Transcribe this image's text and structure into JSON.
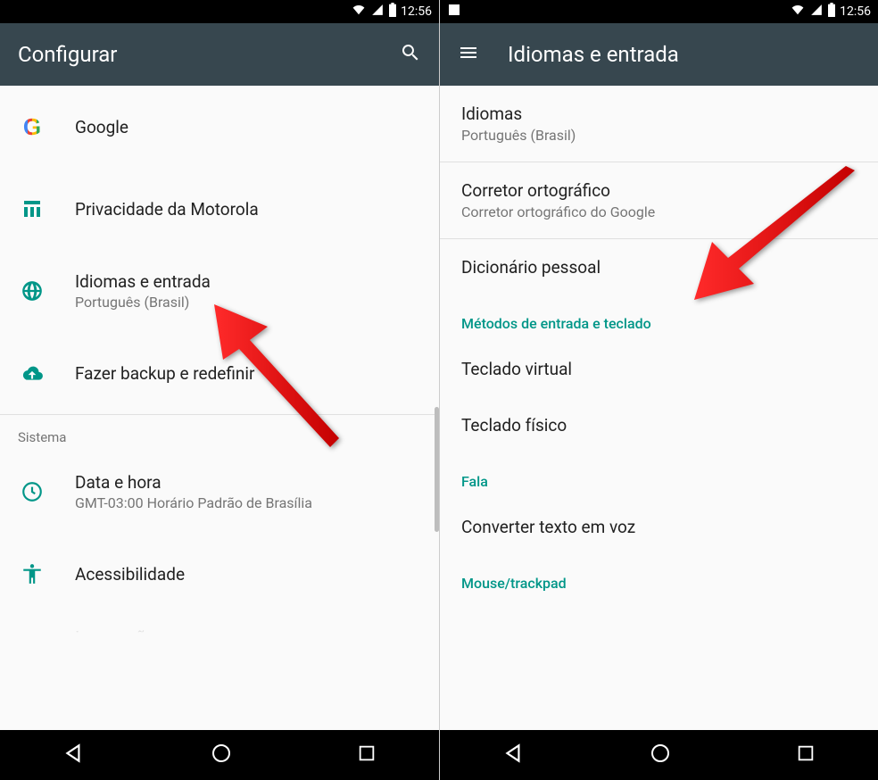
{
  "status": {
    "time": "12:56"
  },
  "left": {
    "title": "Configurar",
    "items": [
      {
        "icon": "google",
        "primary": "Google"
      },
      {
        "icon": "privacy",
        "primary": "Privacidade da Motorola"
      },
      {
        "icon": "globe",
        "primary": "Idiomas e entrada",
        "secondary": "Português (Brasil)"
      },
      {
        "icon": "backup",
        "primary": "Fazer backup e redefinir"
      }
    ],
    "section_sistema": "Sistema",
    "sys_items": [
      {
        "icon": "clock",
        "primary": "Data e hora",
        "secondary": "GMT-03:00 Horário Padrão de Brasília"
      },
      {
        "icon": "accessibility",
        "primary": "Acessibilidade"
      }
    ],
    "cutoff": "Impressão"
  },
  "right": {
    "title": "Idiomas e entrada",
    "items_top": [
      {
        "primary": "Idiomas",
        "secondary": "Português (Brasil)"
      },
      {
        "primary": "Corretor ortográfico",
        "secondary": "Corretor ortográfico do Google"
      },
      {
        "primary": "Dicionário pessoal"
      }
    ],
    "section_input": "Métodos de entrada e teclado",
    "items_input": [
      {
        "primary": "Teclado virtual"
      },
      {
        "primary": "Teclado físico"
      }
    ],
    "section_fala": "Fala",
    "items_fala": [
      {
        "primary": "Converter texto em voz"
      }
    ],
    "section_mouse": "Mouse/trackpad"
  }
}
